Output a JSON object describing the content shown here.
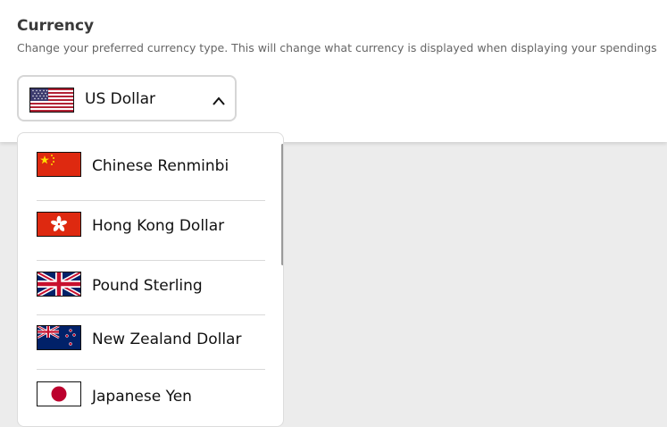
{
  "section": {
    "title": "Currency",
    "description": "Change your preferred currency type. This will change what currency is displayed when displaying your spendings"
  },
  "select": {
    "selected_label": "US Dollar",
    "selected_flag": "us-flag-icon",
    "expanded": true
  },
  "options": [
    {
      "label": "Chinese Renminbi",
      "flag": "china-flag-icon"
    },
    {
      "label": "Hong Kong Dollar",
      "flag": "hong-kong-flag-icon"
    },
    {
      "label": "Pound Sterling",
      "flag": "uk-flag-icon"
    },
    {
      "label": "New Zealand Dollar",
      "flag": "new-zealand-flag-icon"
    },
    {
      "label": "Japanese Yen",
      "flag": "japan-flag-icon"
    }
  ],
  "colors": {
    "background": "#ececec",
    "card": "#ffffff",
    "border": "#d6d6d6",
    "title_text": "#3a3a3a",
    "description_text": "#666666"
  }
}
